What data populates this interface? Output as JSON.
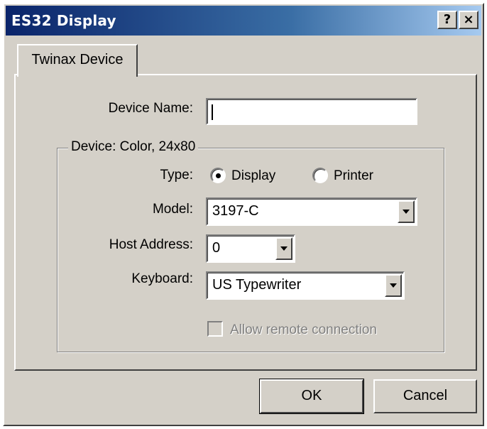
{
  "window": {
    "title": "ES32 Display",
    "help_glyph": "?",
    "close_glyph": "×"
  },
  "tab": {
    "label": "Twinax Device"
  },
  "device_name": {
    "label": "Device Name:",
    "value": ""
  },
  "group": {
    "title": "Device: Color, 24x80",
    "type": {
      "label": "Type:",
      "options": [
        "Display",
        "Printer"
      ],
      "selected": "Display"
    },
    "model": {
      "label": "Model:",
      "value": "3197-C"
    },
    "host_address": {
      "label": "Host Address:",
      "value": "0"
    },
    "keyboard": {
      "label": "Keyboard:",
      "value": "US Typewriter"
    },
    "remote": {
      "label": "Allow remote connection",
      "checked": false,
      "enabled": false
    }
  },
  "buttons": {
    "ok": "OK",
    "cancel": "Cancel"
  }
}
